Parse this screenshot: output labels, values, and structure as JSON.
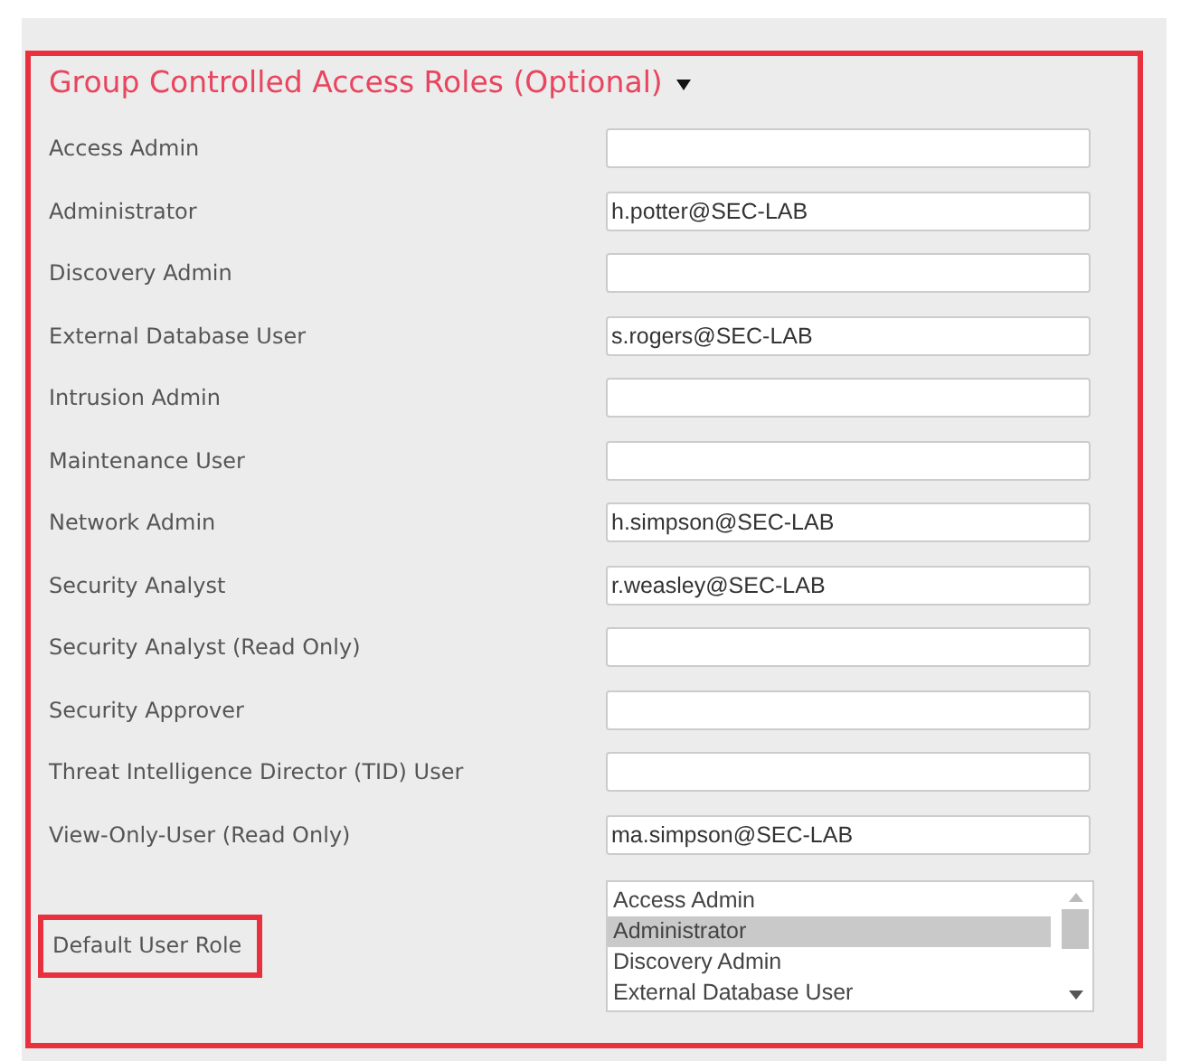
{
  "section": {
    "title": "Group Controlled Access Roles (Optional)",
    "expanded": true,
    "highlighted": true
  },
  "roles": [
    {
      "label": "Access Admin"
    },
    {
      "label": "Administrator",
      "value": "h.potter@SEC-LAB"
    },
    {
      "label": "Discovery Admin"
    },
    {
      "label": "External Database User",
      "value": "s.rogers@SEC-LAB"
    },
    {
      "label": "Intrusion Admin"
    },
    {
      "label": "Maintenance User"
    },
    {
      "label": "Network Admin",
      "value": "h.simpson@SEC-LAB"
    },
    {
      "label": "Security Analyst",
      "value": "r.weasley@SEC-LAB"
    },
    {
      "label": "Security Analyst (Read Only)"
    },
    {
      "label": "Security Approver"
    },
    {
      "label": "Threat Intelligence Director (TID) User"
    },
    {
      "label": "View-Only-User (Read Only)",
      "value": "ma.simpson@SEC-LAB"
    }
  ],
  "default_role": {
    "label": "Default User Role",
    "highlighted": true,
    "options": [
      {
        "label": "Access Admin",
        "selected": false
      },
      {
        "label": "Administrator",
        "selected": true
      },
      {
        "label": "Discovery Admin",
        "selected": false
      },
      {
        "label": "External Database User",
        "selected": false
      }
    ]
  }
}
